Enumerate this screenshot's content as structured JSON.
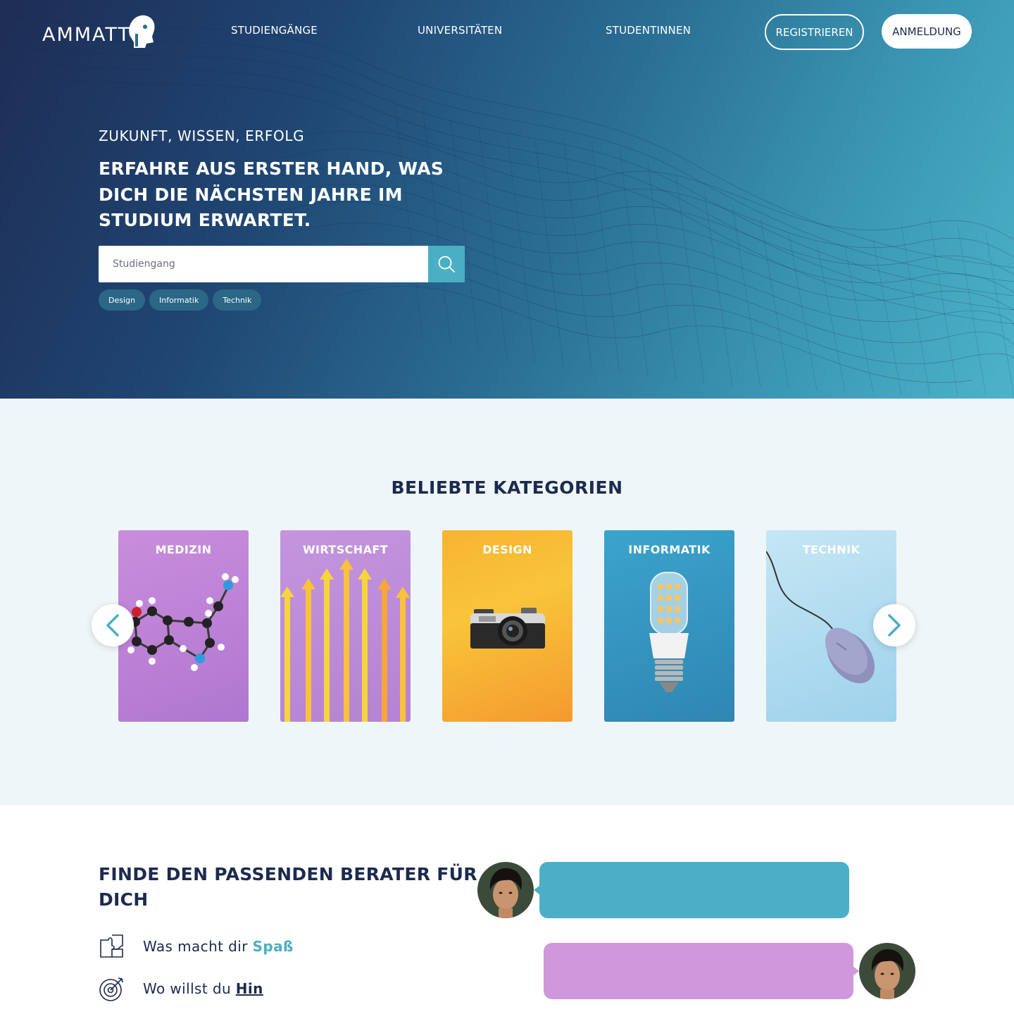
{
  "nav": {
    "logo_text": "AMMATT",
    "links": [
      "STUDIENGÄNGE",
      "UNIVERSITÄTEN",
      "STUDENTINNEN"
    ],
    "register_label": "REGISTRIEREN",
    "login_label": "ANMELDUNG"
  },
  "hero": {
    "kicker": "ZUKUNFT, WISSEN, ERFOLG",
    "headline": "ERFAHRE AUS ERSTER HAND, WAS DICH DIE NÄCHSTEN JAHRE IM STUDIUM ERWARTET.",
    "search_placeholder": "Studiengang",
    "tags": [
      "Design",
      "Informatik",
      "Technik"
    ]
  },
  "categories": {
    "title": "BELIEBTE KATEGORIEN",
    "items": [
      {
        "label": "MEDIZIN",
        "icon": "molecule-image"
      },
      {
        "label": "WIRTSCHAFT",
        "icon": "arrows-up-image"
      },
      {
        "label": "DESIGN",
        "icon": "camera-image"
      },
      {
        "label": "INFORMATIK",
        "icon": "light-bulb-image"
      },
      {
        "label": "TECHNIK",
        "icon": "computer-mouse-image"
      }
    ]
  },
  "advisor": {
    "title": "FINDE DEN PASSENDEN BERATER FÜR DICH",
    "features": [
      {
        "icon": "puzzle-icon",
        "prefix": "Was macht dir ",
        "accent": "Spaß"
      },
      {
        "icon": "target-icon",
        "prefix": "Wo willst du ",
        "accent": "Hin"
      }
    ]
  },
  "colors": {
    "brand_dark": "#1d2a4f",
    "accent_teal": "#4aafc4",
    "accent_purple": "#cf98dc",
    "section_bg": "#eff6f8"
  }
}
